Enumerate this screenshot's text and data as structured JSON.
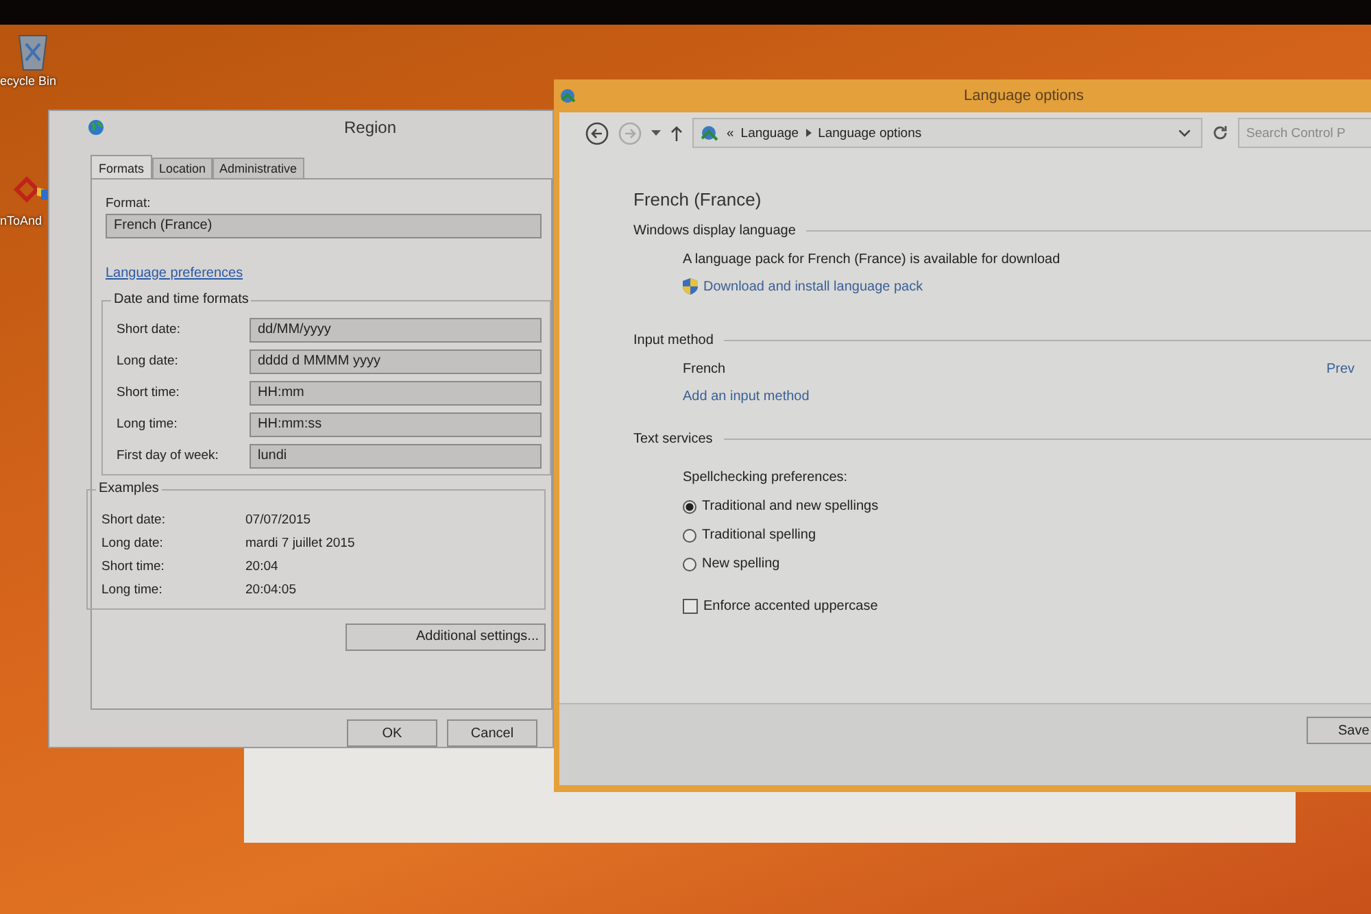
{
  "desktop_icons": [
    {
      "label": "ecycle Bin",
      "kind": "bin"
    },
    {
      "label": "nToAnd",
      "kind": "app"
    }
  ],
  "region_window": {
    "title": "Region",
    "tabs": [
      {
        "label": "Formats",
        "selected": true
      },
      {
        "label": "Location",
        "selected": false
      },
      {
        "label": "Administrative",
        "selected": false
      }
    ],
    "format_label": "Format:",
    "format_value": "French (France)",
    "language_link": "Language preferences",
    "formats_group": "Date and time formats",
    "formats": [
      {
        "label": "Short date:",
        "value": "dd/MM/yyyy"
      },
      {
        "label": "Long date:",
        "value": "dddd d MMMM yyyy"
      },
      {
        "label": "Short time:",
        "value": "HH:mm"
      },
      {
        "label": "Long time:",
        "value": "HH:mm:ss"
      },
      {
        "label": "First day of week:",
        "value": "lundi"
      }
    ],
    "examples_group": "Examples",
    "examples": [
      {
        "label": "Short date:",
        "value": "07/07/2015"
      },
      {
        "label": "Long date:",
        "value": "mardi 7 juillet 2015"
      },
      {
        "label": "Short time:",
        "value": "20:04"
      },
      {
        "label": "Long time:",
        "value": "20:04:05"
      }
    ],
    "additional_button": "Additional settings...",
    "buttons": [
      "OK",
      "Cancel"
    ]
  },
  "language_window": {
    "title": "Language options",
    "breadcrumb_prefix": "«",
    "breadcrumb": [
      "Language",
      "Language options"
    ],
    "search": {
      "placeholder": "Search Control P"
    },
    "heading": "French (France)",
    "display_section": {
      "title": "Windows display language",
      "message": "A language pack for French (France) is available for download",
      "link": "Download and install language pack"
    },
    "input_section": {
      "title": "Input method",
      "method": "French",
      "method_link": "Prev",
      "add_link": "Add an input method"
    },
    "text_section": {
      "title": "Text services",
      "prompt": "Spellchecking preferences:",
      "options": [
        {
          "label": "Traditional and new spellings",
          "selected": true
        },
        {
          "label": "Traditional spelling",
          "selected": false
        },
        {
          "label": "New spelling",
          "selected": false
        }
      ],
      "checkbox": {
        "label": "Enforce accented uppercase",
        "checked": false
      }
    },
    "save_button": "Save"
  }
}
